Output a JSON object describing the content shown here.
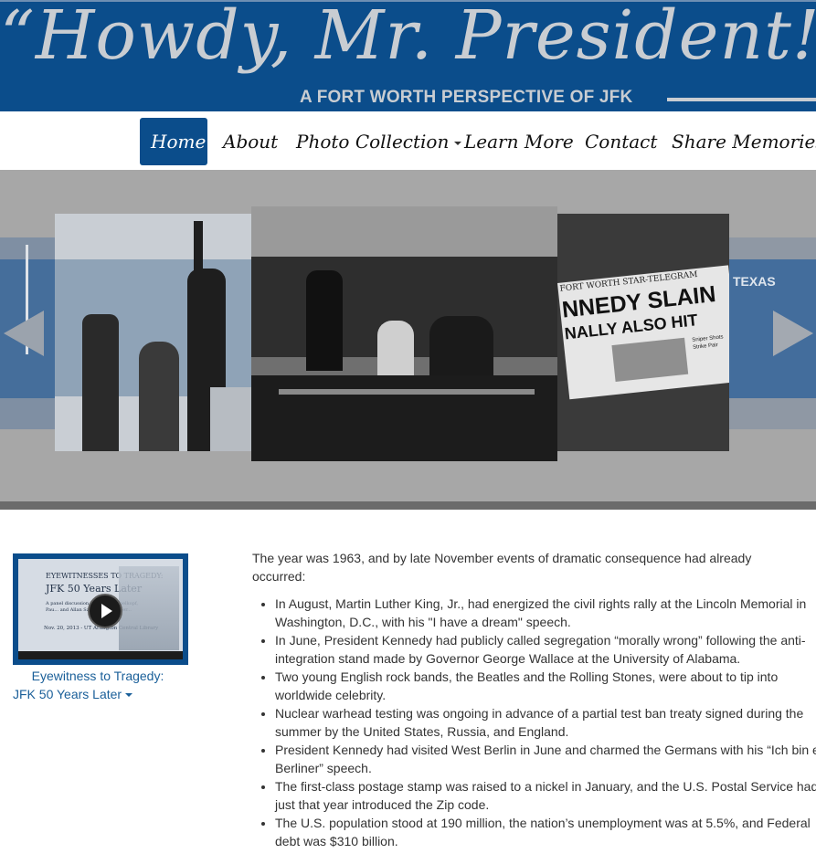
{
  "header": {
    "title": "“Howdy, Mr. President!”",
    "subtitle": "A FORT WORTH PERSPECTIVE OF JFK"
  },
  "nav": {
    "items": [
      {
        "label": "Home",
        "active": true
      },
      {
        "label": "About"
      },
      {
        "label": "Photo Collection",
        "dropdown": true
      },
      {
        "label": "Learn More"
      },
      {
        "label": "Contact"
      },
      {
        "label": "Share Memories"
      }
    ]
  },
  "slider": {
    "newspaper_masthead": "FORT WORTH STAR-TELEGRAM",
    "newspaper_headline_1": "NNEDY SLAIN",
    "newspaper_headline_2": "NALLY ALSO HIT",
    "newspaper_small": "Sniper Shots Strike Pair",
    "building_sign": "TEXAS",
    "prev_icon": "arrow-left-icon",
    "next_icon": "arrow-right-icon"
  },
  "sidebar": {
    "video": {
      "title_line1": "EYEWITNESSES TO TRAGEDY:",
      "title_line2": "JFK 50 Years Later",
      "desc": "A panel discussion with John Shoelkopf, Pau... and Allan Saxe. Mode... Deer...",
      "date_line": "Nov. 20, 2013 - UT Arlington Central Library"
    },
    "caption_line1": "Eyewitness to Tragedy:",
    "caption_line2": "JFK 50 Years Later"
  },
  "content": {
    "intro": "The year was 1963, and by late November events of dramatic consequence had already occurred:",
    "facts": [
      "In August, Martin Luther King, Jr., had energized the civil rights rally at the Lincoln Memorial in Washington, D.C., with his \"I have a dream\" speech.",
      "In June, President Kennedy had publicly called segregation “morally wrong” following the anti-integration stand made by Governor George Wallace at the University of Alabama.",
      "Two young English rock bands, the Beatles and the Rolling Stones, were about to tip into worldwide celebrity.",
      "Nuclear warhead testing was ongoing in advance of a partial test ban treaty signed during the summer by the United States, Russia, and England.",
      "President Kennedy had visited West Berlin in June and charmed the Germans with his “Ich bin ein Berliner” speech.",
      "The first-class postage stamp was raised to a nickel in January, and the U.S. Postal Service had just that year introduced the Zip code.",
      "The U.S. population stood at 190 million, the nation’s unemployment was at 5.5%, and Federal debt was $310 billion."
    ]
  },
  "colors": {
    "brand_blue": "#0b4d8b",
    "banner_text": "#c9cdd2",
    "link_blue": "#1a5f99"
  }
}
